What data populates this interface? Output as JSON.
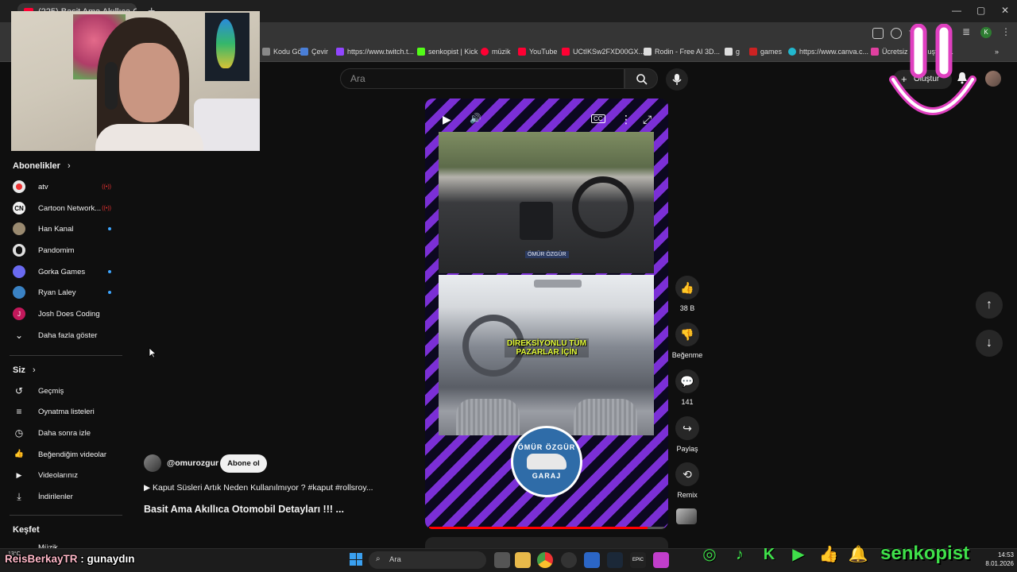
{
  "browser": {
    "tab_title": "(225) Basit Ama Akıllıca Otom...",
    "new_tab": "+",
    "window_controls": [
      "—",
      "▢",
      "✕"
    ],
    "profile_letter": "K",
    "bookmarks": [
      {
        "label": "Kodu Gö...",
        "color": "#888888"
      },
      {
        "label": "Çevir",
        "color": "#4a7fd8"
      },
      {
        "label": "https://www.twitch.t...",
        "color": "#9146ff"
      },
      {
        "label": "senkopist | Kick",
        "color": "#53fc18"
      },
      {
        "label": "müzik",
        "color": "#ff0033"
      },
      {
        "label": "YouTube",
        "color": "#ff0033"
      },
      {
        "label": "UCtIKSw2FXD00GX...",
        "color": "#ff0033"
      },
      {
        "label": "Rodin - Free AI 3D...",
        "color": "#dddddd"
      },
      {
        "label": "g",
        "color": "#dddddd"
      },
      {
        "label": "games",
        "color": "#cc2222"
      },
      {
        "label": "https://www.canva.c...",
        "color": "#22b8cf"
      },
      {
        "label": "Ücretsiz PN... uşturu...",
        "color": "#e040a0"
      }
    ],
    "bookmarks_more": "»"
  },
  "youtube": {
    "search_placeholder": "Ara",
    "create_label": "Oluştur",
    "sidebar": {
      "subscriptions_heading": "Abonelikler",
      "subscriptions": [
        {
          "label": "atv",
          "status": "live",
          "color": "#e8e8e8",
          "glyph": ""
        },
        {
          "label": "Cartoon Network...",
          "status": "live",
          "color": "#f1f1f1",
          "glyph": "CN"
        },
        {
          "label": "Han Kanal",
          "status": "new",
          "color": "#9a8a70",
          "glyph": ""
        },
        {
          "label": "Pandomim",
          "status": "",
          "color": "#e0e0e0",
          "glyph": ""
        },
        {
          "label": "Gorka Games",
          "status": "new",
          "color": "#6a6af0",
          "glyph": ""
        },
        {
          "label": "Ryan Laley",
          "status": "new",
          "color": "#3a82c4",
          "glyph": ""
        },
        {
          "label": "Josh Does Coding",
          "status": "",
          "color": "#c2185b",
          "glyph": "J"
        }
      ],
      "show_more": "Daha fazla göster",
      "you_heading": "Siz",
      "you_items": [
        {
          "label": "Geçmiş",
          "icon": "history-icon",
          "glyph": "↺"
        },
        {
          "label": "Oynatma listeleri",
          "icon": "playlists-icon",
          "glyph": "≡"
        },
        {
          "label": "Daha sonra izle",
          "icon": "watch-later-icon",
          "glyph": "◷"
        },
        {
          "label": "Beğendiğim videolar",
          "icon": "liked-videos-icon",
          "glyph": "👍"
        },
        {
          "label": "Videolarınız",
          "icon": "your-videos-icon",
          "glyph": "▶"
        },
        {
          "label": "İndirilenler",
          "icon": "downloads-icon",
          "glyph": "⤓"
        }
      ],
      "explore_heading": "Keşfet",
      "explore_partial": "Müzik"
    },
    "short": {
      "overlay_top": "ÖMÜR ÖZGÜR",
      "overlay_mid": "DİREKSİYONLU TÜM PAZARLAR İÇİN",
      "logo_top": "ÖMÜR ÖZGÜR",
      "logo_bottom": "GARAJ",
      "progress": 0.93,
      "controls": {
        "play": "▶",
        "volume": "🔊",
        "cc": "CC",
        "more": "⋮",
        "fullscreen": "⤢"
      }
    },
    "channel": {
      "handle": "@omurozgur",
      "subscribe_label": "Abone ol",
      "description": "▶ Kaput Süsleri Artık Neden Kullanılmıyor ? #kaput #rollsroy...",
      "title": "Basit Ama Akıllıca Otomobil Detayları !!! ..."
    },
    "actions": {
      "like_count": "38 B",
      "dislike_label": "Beğenme",
      "comment_count": "141",
      "share_label": "Paylaş",
      "remix_label": "Remix"
    }
  },
  "stream_overlay": {
    "chat_user": "ReisBerkayTR",
    "chat_message": " : gunaydın",
    "brand": "senkopist",
    "weather": "13°C"
  },
  "taskbar": {
    "search_placeholder": "Ara",
    "time": "14:53",
    "date": "8.01.2026"
  }
}
